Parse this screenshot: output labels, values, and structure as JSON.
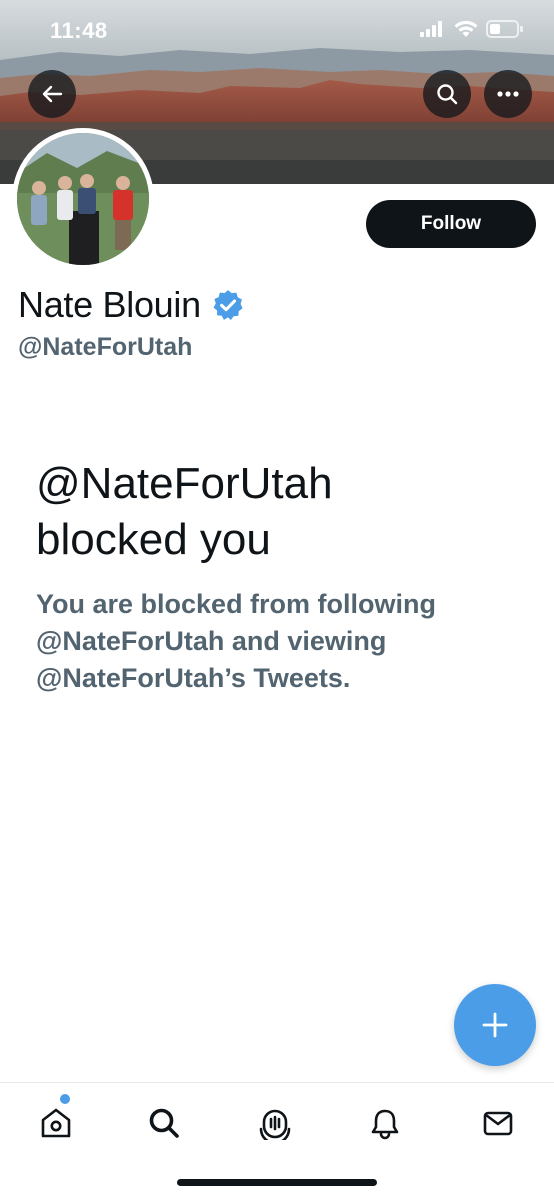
{
  "status_bar": {
    "time": "11:48",
    "icons": [
      "signal-icon",
      "wifi-icon",
      "battery-icon"
    ]
  },
  "header": {
    "back_icon": "arrow-left-icon",
    "search_icon": "search-icon",
    "more_icon": "more-icon"
  },
  "profile": {
    "display_name": "Nate Blouin",
    "verified": true,
    "handle": "@NateForUtah",
    "follow_label": "Follow"
  },
  "blocked": {
    "title_line1": "@NateForUtah",
    "title_line2": "blocked you",
    "desc_line1": "You are blocked from following",
    "desc_line2": "@NateForUtah and viewing",
    "desc_line3": "@NateForUtah’s Tweets."
  },
  "fab": {
    "icon": "plus-icon"
  },
  "bottom_nav": {
    "items": [
      "home-icon",
      "search-icon",
      "spaces-icon",
      "notifications-icon",
      "messages-icon"
    ]
  },
  "colors": {
    "accent": "#4a9de6",
    "text_primary": "#0f1419",
    "text_secondary": "#536471",
    "verified": "#4a9de6"
  }
}
